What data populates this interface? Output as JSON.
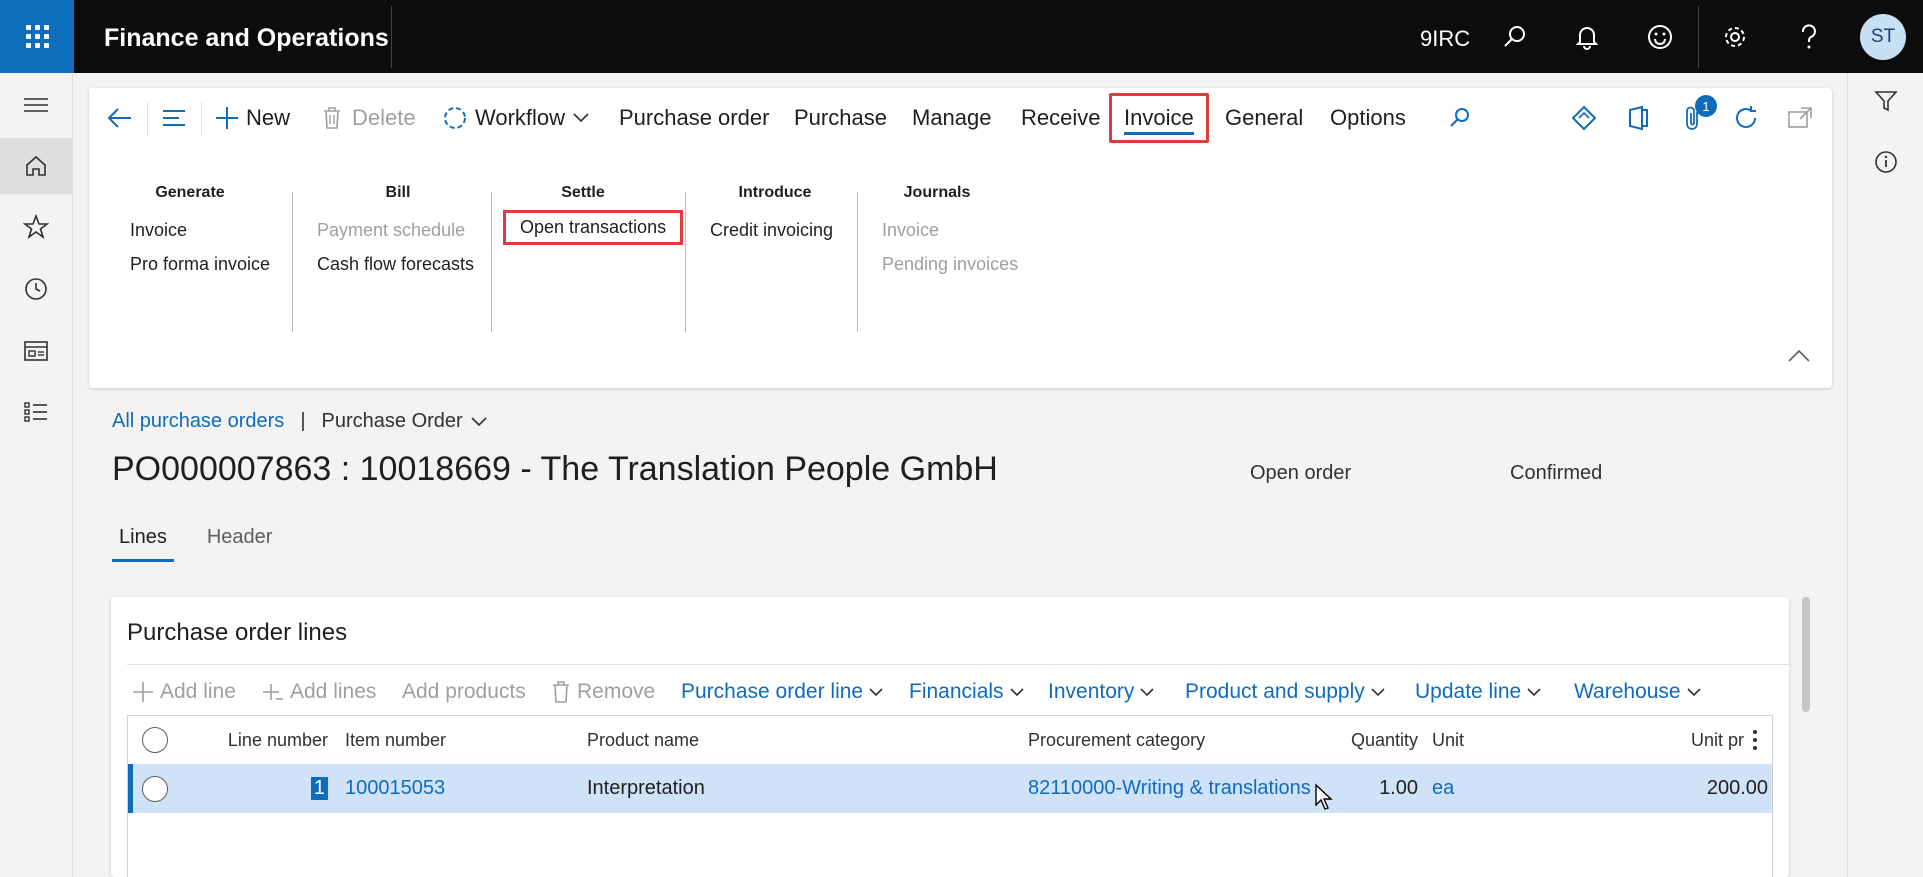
{
  "app": {
    "title": "Finance and Operations",
    "company": "9IRC",
    "user_initials": "ST"
  },
  "topbar_icons": [
    "search-icon",
    "bell-icon",
    "smiley-icon",
    "gear-icon",
    "help-icon"
  ],
  "leftnav": [
    "hamburger-icon",
    "home-icon",
    "star-icon",
    "clock-icon",
    "workspace-icon",
    "modules-icon"
  ],
  "rightrail": [
    "filter-icon",
    "info-icon"
  ],
  "actionpane": {
    "new_label": "New",
    "delete_label": "Delete",
    "workflow_label": "Workflow",
    "tabs": [
      "Purchase order",
      "Purchase",
      "Manage",
      "Receive",
      "Invoice",
      "General",
      "Options"
    ],
    "selected_tab": "Invoice",
    "attachment_count": "1",
    "groups": {
      "generate": {
        "title": "Generate",
        "items": [
          "Invoice",
          "Pro forma invoice"
        ]
      },
      "bill": {
        "title": "Bill",
        "items": [
          "Payment schedule",
          "Cash flow forecasts"
        ]
      },
      "settle": {
        "title": "Settle",
        "items": [
          "Open transactions"
        ]
      },
      "introduce": {
        "title": "Introduce",
        "items": [
          "Credit invoicing"
        ]
      },
      "journals": {
        "title": "Journals",
        "items": [
          "Invoice",
          "Pending invoices"
        ]
      }
    }
  },
  "breadcrumb": {
    "link": "All purchase orders",
    "separator": "|",
    "view": "Purchase Order"
  },
  "page": {
    "title": "PO000007863 : 10018669 - The Translation People GmbH",
    "status_1": "Open order",
    "status_2": "Confirmed",
    "tabs": [
      "Lines",
      "Header"
    ]
  },
  "lines": {
    "title": "Purchase order lines",
    "toolbar": {
      "add_line": "Add line",
      "add_lines": "Add lines",
      "add_products": "Add products",
      "remove": "Remove",
      "menus": [
        "Purchase order line",
        "Financials",
        "Inventory",
        "Product and supply",
        "Update line",
        "Warehouse"
      ]
    },
    "columns": [
      "Line number",
      "Item number",
      "Product name",
      "Procurement category",
      "Quantity",
      "Unit",
      "Unit pr"
    ],
    "rows": [
      {
        "line_number": "1",
        "item_number": "100015053",
        "product_name": "Interpretation",
        "procurement_category": "82110000-Writing & translations",
        "quantity": "1.00",
        "unit": "ea",
        "unit_price": "200.00"
      }
    ]
  },
  "colors": {
    "accent": "#0f6cbd",
    "highlight": "#e03b3b",
    "topbar": "#0c0c0c",
    "waffle": "#106ebe",
    "selected_row": "#cfe2f8"
  }
}
